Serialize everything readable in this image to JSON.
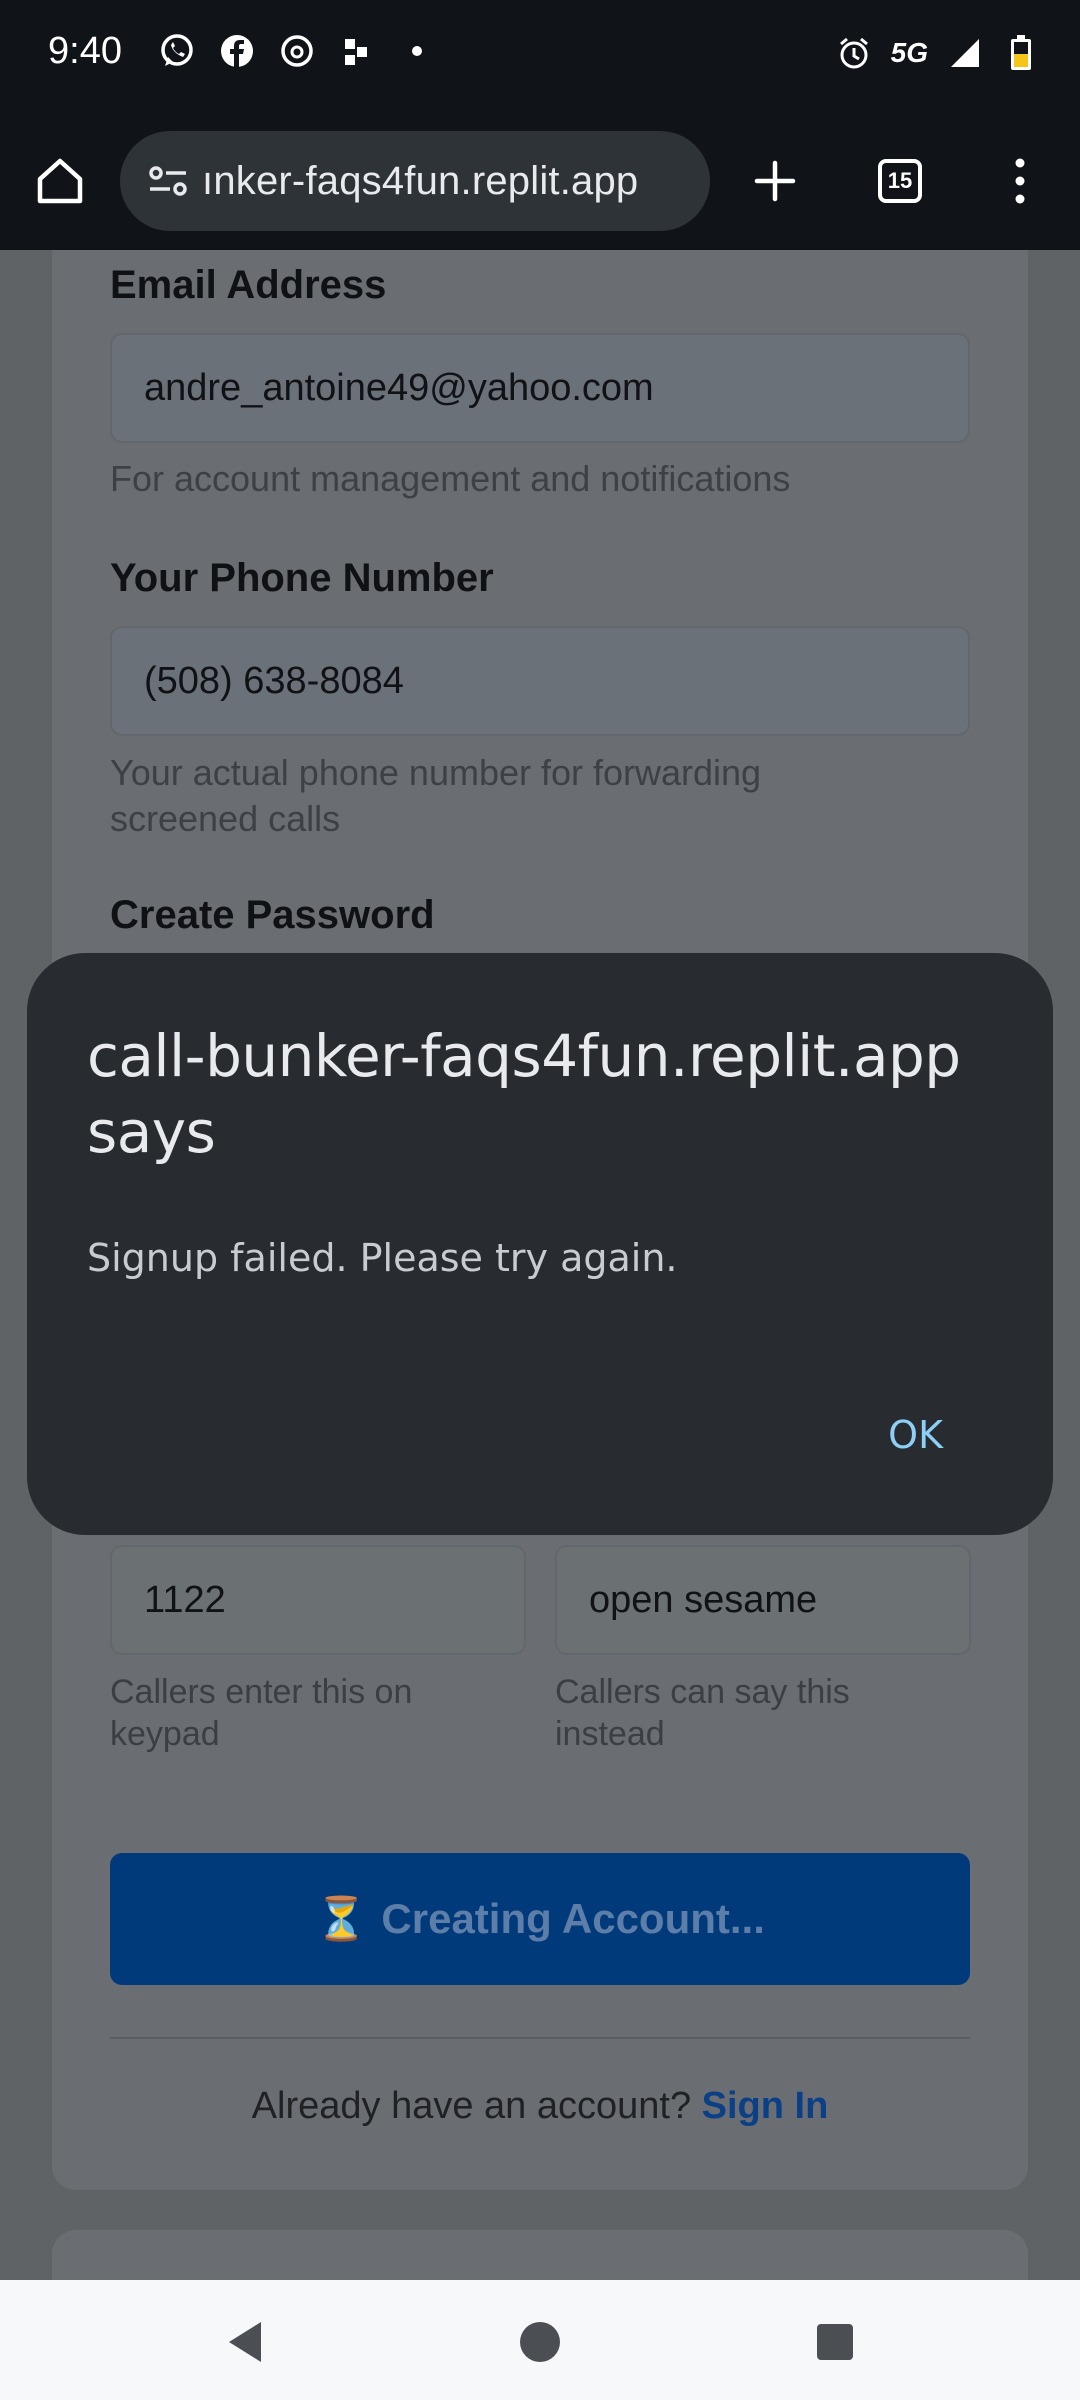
{
  "status_bar": {
    "time": "9:40",
    "network": "5G",
    "left_icons": [
      "whatsapp-icon",
      "facebook-icon",
      "threads-icon",
      "app-icon",
      "dot-icon"
    ],
    "right_icons": [
      "alarm-icon",
      "signal-icon",
      "battery-icon"
    ]
  },
  "browser": {
    "url": "ınker-faqs4fun.replit.app",
    "tab_count": "15"
  },
  "form": {
    "email_label": "Email Address",
    "email_value": "andre_antoine49@yahoo.com",
    "email_hint": "For account management and notifications",
    "phone_label": "Your Phone Number",
    "phone_value": "(508) 638-8084",
    "phone_hint": "Your actual phone number for forwarding screened calls",
    "password_label": "Create Password",
    "pin_value": "1122",
    "pin_hint": "Callers enter this on keypad",
    "phrase_value": "open sesame",
    "phrase_hint": "Callers can say this instead",
    "submit_icon": "⏳",
    "submit_label": "Creating Account...",
    "signin_prompt": "Already have an account?",
    "signin_link": "Sign In"
  },
  "dialog": {
    "title": "call-bunker-faqs4fun.replit.app says",
    "message": "Signup failed. Please try again.",
    "ok_label": "OK",
    "accent": "#8ecff5"
  },
  "colors": {
    "status_bg": "#101418",
    "dialog_bg": "#282c30",
    "link": "#0b3f86"
  }
}
